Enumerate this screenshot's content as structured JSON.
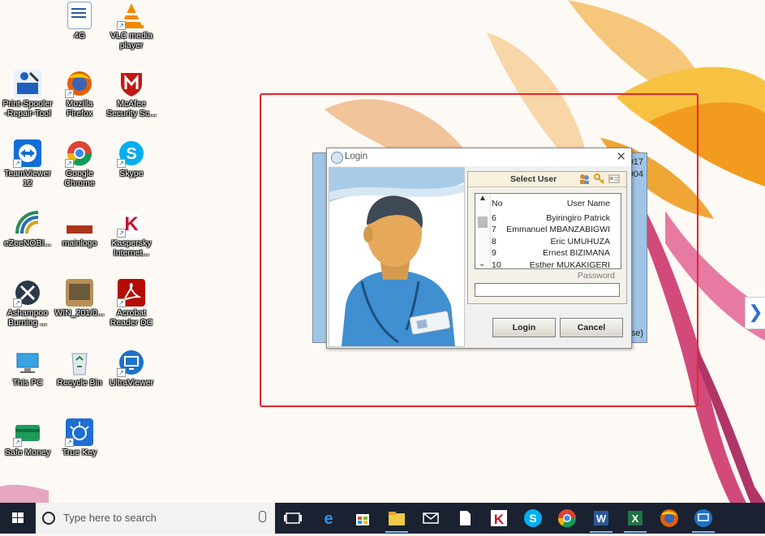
{
  "desktop": {
    "icons": [
      {
        "label": "4G"
      },
      {
        "label": "VLC media player"
      },
      {
        "label": "Print-Spooler -Repair-Tool"
      },
      {
        "label": "Mozilla Firefox"
      },
      {
        "label": "McAfee Security Sc..."
      },
      {
        "label": "TeamViewer 12"
      },
      {
        "label": "Google Chrome"
      },
      {
        "label": "Skype"
      },
      {
        "label": "eZeeNOBI..."
      },
      {
        "label": "mainlogo"
      },
      {
        "label": "Kaspersky Internet..."
      },
      {
        "label": "Ashampoo Burning ..."
      },
      {
        "label": "WIN_201/0..."
      },
      {
        "label": "Acrobat Reader DC"
      },
      {
        "label": "This PC"
      },
      {
        "label": "Recycle Bin"
      },
      {
        "label": "UltraViewer"
      },
      {
        "label": "Safe Money"
      },
      {
        "label": "True Key"
      }
    ]
  },
  "background_window": {
    "line1": "017",
    "line2": "004",
    "line3": "se)"
  },
  "login_dialog": {
    "title": "Login",
    "close_glyph": "✕",
    "select_user_title": "Select User",
    "list": {
      "header_no": "No",
      "header_name": "User Name",
      "rows": [
        {
          "no": "6",
          "name": "Byiringiro  Patrick"
        },
        {
          "no": "7",
          "name": "Emmanuel MBANZABIGWI"
        },
        {
          "no": "8",
          "name": "Eric UMUHUZA"
        },
        {
          "no": "9",
          "name": "Ernest BIZIMANA"
        },
        {
          "no": "10",
          "name": "Esther MUKAKIGERI"
        }
      ]
    },
    "password_label": "Password",
    "password_value": "",
    "login_button": "Login",
    "cancel_button": "Cancel"
  },
  "side_panel_glyph": "❯",
  "taskbar": {
    "search_placeholder": "Type here to search"
  },
  "colors": {
    "highlight": "#e8262a",
    "taskbar": "#1a2231",
    "dialog_bg": "#f0f0f0"
  }
}
